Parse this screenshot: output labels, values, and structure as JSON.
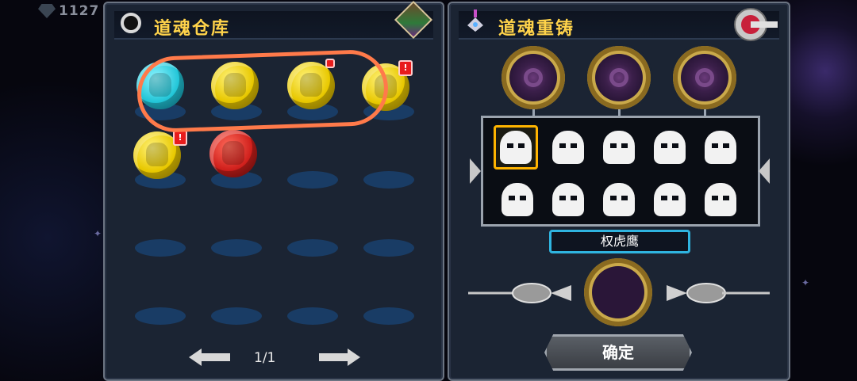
{
  "topbar": {
    "gems": "1127",
    "gem_icon": "diamond-gem-icon"
  },
  "left_panel": {
    "title": "道魂仓库",
    "page_indicator": "1/1",
    "orbs": [
      {
        "color": "cyan",
        "badge": ""
      },
      {
        "color": "gold",
        "badge": ""
      },
      {
        "color": "gold",
        "badge": "!"
      },
      {
        "color": "gold",
        "badge": "!"
      },
      {
        "color": "gold",
        "badge": "!"
      },
      {
        "color": "red",
        "badge": ""
      }
    ],
    "highlight_color": "#ff7a4a"
  },
  "right_panel": {
    "title": "道魂重铸",
    "selected_name": "权虎鹰",
    "confirm_label": "确定",
    "characters_row1": [
      "char-1",
      "char-2",
      "char-3",
      "char-4",
      "char-5"
    ],
    "characters_row2": [
      "char-6",
      "char-7",
      "char-8",
      "char-9",
      "char-10"
    ],
    "selected_index": 0
  },
  "colors": {
    "title": "#ffd34a",
    "gold": "#e8c800",
    "cyan": "#23c6d8",
    "red": "#d0201c",
    "select_border": "#ffb400",
    "name_border": "#2fb4e0"
  }
}
